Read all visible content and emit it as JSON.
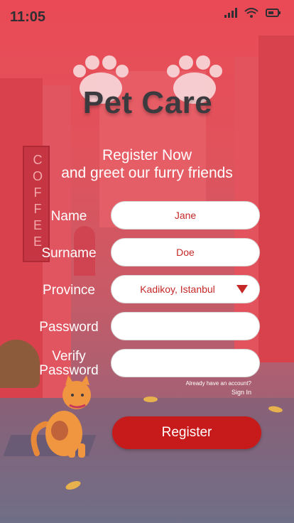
{
  "status": {
    "time": "11:05"
  },
  "logo": {
    "title": "Pet Care"
  },
  "headline": {
    "line1": "Register Now",
    "line2": "and greet our furry friends"
  },
  "sign": {
    "text": "COFFEE"
  },
  "form": {
    "name_label": "Name",
    "name_value": "Jane",
    "surname_label": "Surname",
    "surname_value": "Doe",
    "province_label": "Province",
    "province_value": "Kadikoy, Istanbul",
    "password_label": "Password",
    "password_value": "",
    "verify_label_line1": "Verify",
    "verify_label_line2": "Password",
    "verify_value": ""
  },
  "account": {
    "prompt": "Already have an account?",
    "signin_label": "Sign In"
  },
  "register_label": "Register",
  "colors": {
    "accent": "#c71a1a",
    "text_dark": "#3b3b3f",
    "field_text": "#c62828"
  },
  "icons": [
    "signal-icon",
    "wifi-icon",
    "battery-icon",
    "paw-icon",
    "dropdown-caret-icon",
    "cat-illustration"
  ]
}
